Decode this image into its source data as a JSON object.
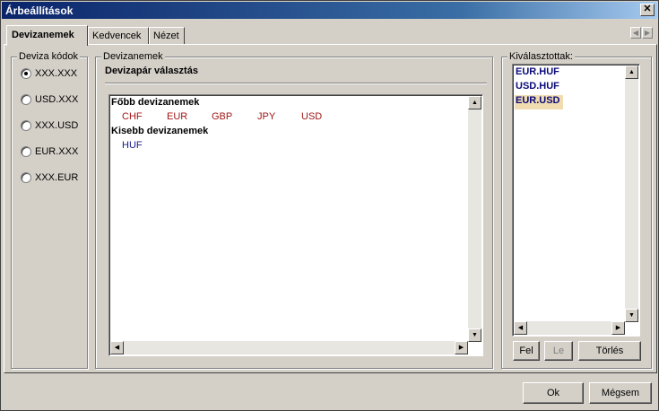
{
  "window": {
    "title": "Árbeállítások",
    "close_glyph": "✕"
  },
  "tabs": [
    {
      "label": "Devizanemek"
    },
    {
      "label": "Kedvencek"
    },
    {
      "label": "Nézet"
    }
  ],
  "codes_group": {
    "title": "Deviza kódok",
    "options": [
      {
        "label": "XXX.XXX",
        "checked": true
      },
      {
        "label": "USD.XXX",
        "checked": false
      },
      {
        "label": "XXX.USD",
        "checked": false
      },
      {
        "label": "EUR.XXX",
        "checked": false
      },
      {
        "label": "XXX.EUR",
        "checked": false
      }
    ]
  },
  "currencies_group": {
    "title": "Devizanemek",
    "subtitle": "Devizapár választás",
    "major": {
      "heading": "Főbb devizanemek",
      "items": [
        "CHF",
        "EUR",
        "GBP",
        "JPY",
        "USD"
      ]
    },
    "minor": {
      "heading": "Kisebb devizanemek",
      "items": [
        "HUF"
      ]
    }
  },
  "selected_group": {
    "title": "Kiválasztottak:",
    "items": [
      {
        "label": "EUR.HUF",
        "highlighted": false
      },
      {
        "label": "USD.HUF",
        "highlighted": false
      },
      {
        "label": "EUR.USD",
        "highlighted": true
      }
    ],
    "buttons": {
      "up": "Fel",
      "down": "Le",
      "delete": "Törlés"
    }
  },
  "footer": {
    "ok": "Ok",
    "cancel": "Mégsem"
  },
  "colors": {
    "major_currency": "#a01818",
    "minor_currency": "#1a1a8c",
    "selected_item": "#0a0a7a",
    "highlight_bg": "#f0dcb0"
  }
}
